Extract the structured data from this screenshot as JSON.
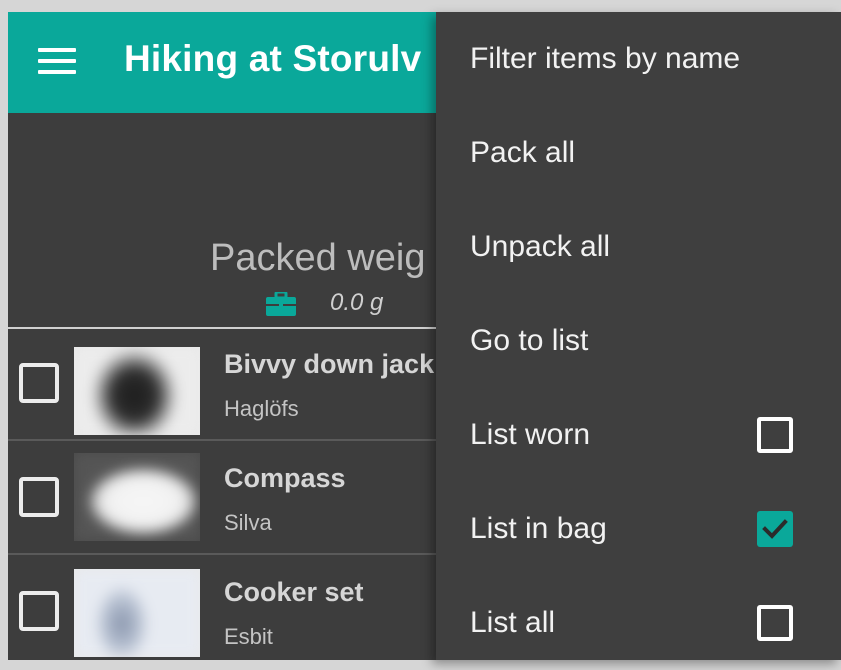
{
  "toolbar": {
    "title": "Hiking at Storulv",
    "menu_icon": "hamburger-menu-icon"
  },
  "summary": {
    "label": "Packed weig",
    "weight": "0.0 g",
    "icon": "briefcase-icon"
  },
  "items": [
    {
      "name": "Bivvy down jack",
      "brand": "Haglöfs",
      "checked": false
    },
    {
      "name": "Compass",
      "brand": "Silva",
      "checked": false
    },
    {
      "name": "Cooker set",
      "brand": "Esbit",
      "checked": false
    }
  ],
  "menu": {
    "items": [
      {
        "label": "Filter items by name"
      },
      {
        "label": "Pack all"
      },
      {
        "label": "Unpack all"
      },
      {
        "label": "Go to list"
      },
      {
        "label": "List worn",
        "checkbox": true,
        "checked": false
      },
      {
        "label": "List in bag",
        "checkbox": true,
        "checked": true
      },
      {
        "label": "List all",
        "checkbox": true,
        "checked": false
      }
    ]
  },
  "colors": {
    "accent": "#0aa89a",
    "background": "#3d3d3d",
    "menu_background": "#3f3f3f",
    "text": "#f2f2f2"
  }
}
